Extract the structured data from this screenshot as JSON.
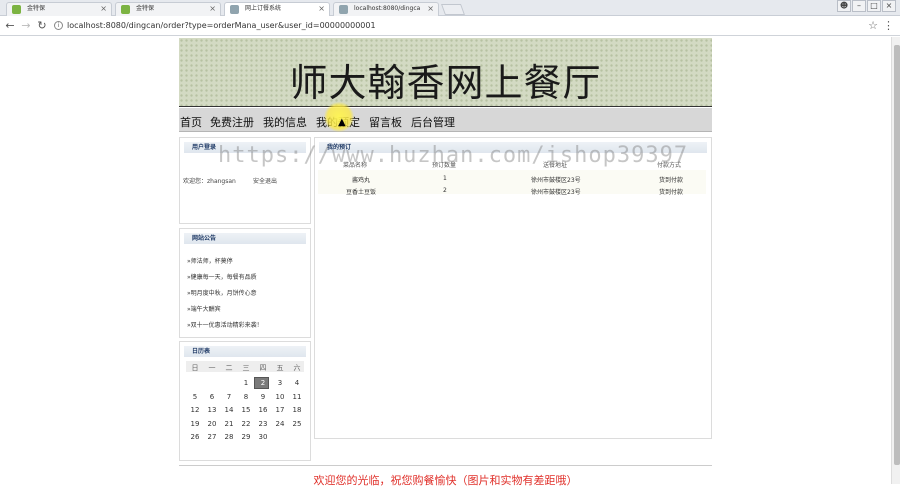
{
  "browser": {
    "tabs": [
      {
        "title": "金特保",
        "favicon_color": "#7cb342"
      },
      {
        "title": "金特保",
        "favicon_color": "#7cb342"
      },
      {
        "title": "网上订餐系统",
        "favicon_color": "#90a4ae"
      },
      {
        "title": "localhost:8080/dingca",
        "favicon_color": "#90a4ae"
      }
    ],
    "url": "localhost:8080/dingcan/order?type=orderMana_user&user_id=00000000001",
    "close_glyph": "×"
  },
  "site": {
    "title": "师大翰香网上餐厅",
    "nav": [
      "首页",
      "免费注册",
      "我的信息",
      "我的预定",
      "留言板",
      "后台管理"
    ]
  },
  "login_panel": {
    "heading": "用户登录",
    "welcome": "欢迎您：zhangsan",
    "logout": "安全退出"
  },
  "notice_panel": {
    "heading": "网站公告",
    "items": [
      "»师法师，杯莫停",
      "»健康每一天，每餐有品质",
      "»明月度中秋，月饼传心意",
      "»端午大酬宾",
      "»双十一优惠活动精彩来袭！"
    ]
  },
  "calendar_panel": {
    "heading": "日历表",
    "weekdays": [
      "日",
      "一",
      "二",
      "三",
      "四",
      "五",
      "六"
    ],
    "weeks": [
      [
        "",
        "",
        "",
        "1",
        "2",
        "3",
        "4"
      ],
      [
        "5",
        "6",
        "7",
        "8",
        "9",
        "10",
        "11"
      ],
      [
        "12",
        "13",
        "14",
        "15",
        "16",
        "17",
        "18"
      ],
      [
        "19",
        "20",
        "21",
        "22",
        "23",
        "24",
        "25"
      ],
      [
        "26",
        "27",
        "28",
        "29",
        "30",
        "",
        ""
      ]
    ],
    "today": "2"
  },
  "orders_panel": {
    "heading": "我的预订",
    "columns": [
      "菜品名称",
      "预订数量",
      "送餐地址",
      "付款方式"
    ],
    "rows": [
      [
        "酱鸡丸",
        "1",
        "徐州市鼓楼区23号",
        "货到付款"
      ],
      [
        "豆香土豆饭",
        "2",
        "徐州市鼓楼区23号",
        "货到付款"
      ]
    ]
  },
  "footer": "欢迎您的光临，祝您购餐愉快（图片和实物有差距哦）",
  "watermark": "https://www.huzhan.com/ishop39397"
}
